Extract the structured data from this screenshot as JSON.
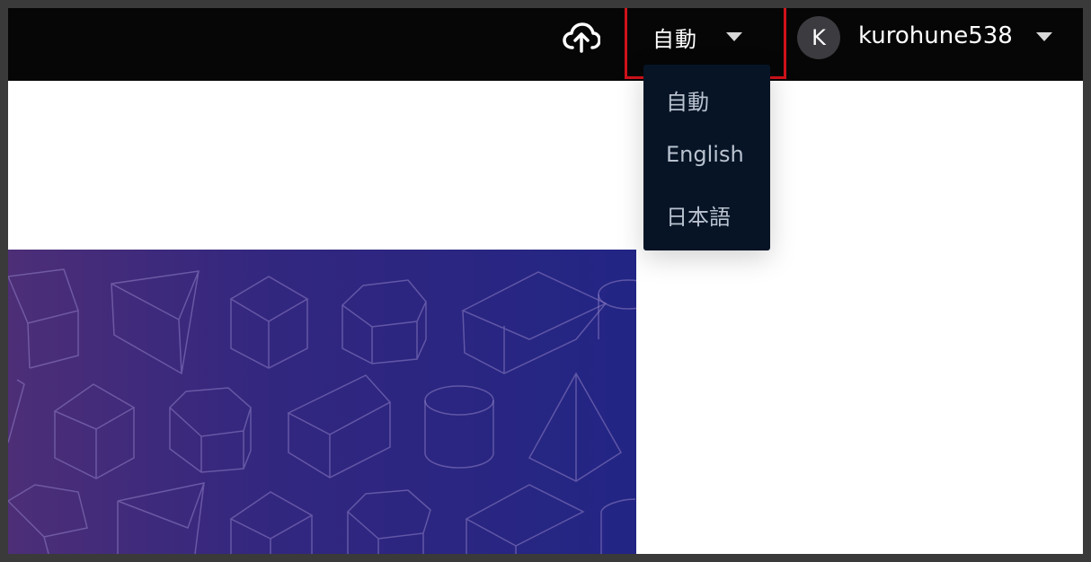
{
  "header": {
    "upload_icon": "cloud-upload-icon",
    "language": {
      "current": "自動",
      "options": [
        "自動",
        "English",
        "日本語"
      ]
    },
    "user": {
      "avatar_initial": "K",
      "username": "kurohune538"
    }
  },
  "colors": {
    "topbar": "#060606",
    "dropdown_bg": "#061426",
    "dropdown_text": "#b9c2cf",
    "highlight": "#d0121b",
    "banner_start": "#4d2e77",
    "banner_end": "#222584",
    "shape_stroke": "#8f7fc4"
  }
}
